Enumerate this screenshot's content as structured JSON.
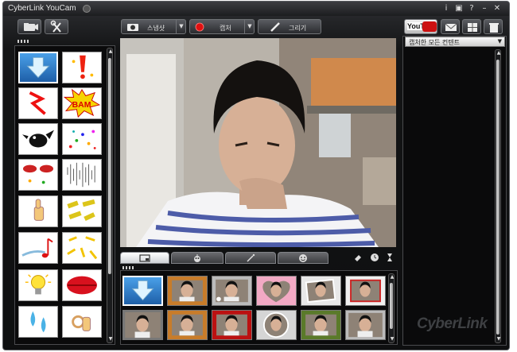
{
  "window": {
    "title": "CyberLink YouCam",
    "controls": {
      "info": "i",
      "settings": "▣",
      "help": "?",
      "minimize": "–",
      "close": "✕"
    }
  },
  "toolbar": {
    "snapshot_label": "스냅샷",
    "capture_label": "캡처",
    "draw_label": "그리기",
    "youtube_label": "YouTube",
    "record_color": "#e01010"
  },
  "right_panel": {
    "dropdown_label": "캡처한 모든 컨텐트",
    "brand_text": "CyberLink"
  },
  "effects_panel": {
    "items": [
      "blank-arrow",
      "exclamation",
      "zigzag-burst",
      "bam-burst",
      "black-bird",
      "confetti",
      "red-lips-pair",
      "sound-lines",
      "thumbs-up-hand",
      "yellow-wave-words",
      "music-note-swoosh",
      "yellow-burst-marks",
      "light-bulb",
      "big-lips",
      "water-drops",
      "ok-hand"
    ],
    "selected_index": 0
  },
  "bottom_tabs": [
    "capture-tab",
    "effects-tab",
    "magic-wand-tab",
    "face-tab"
  ],
  "bottom_tools": [
    "eraser-icon",
    "timer-icon",
    "hourglass-icon"
  ],
  "gallery": {
    "count": 12,
    "selected_index": 0
  },
  "colors": {
    "accent_blue": "#2a78c8",
    "youtube_red": "#cc1111"
  }
}
